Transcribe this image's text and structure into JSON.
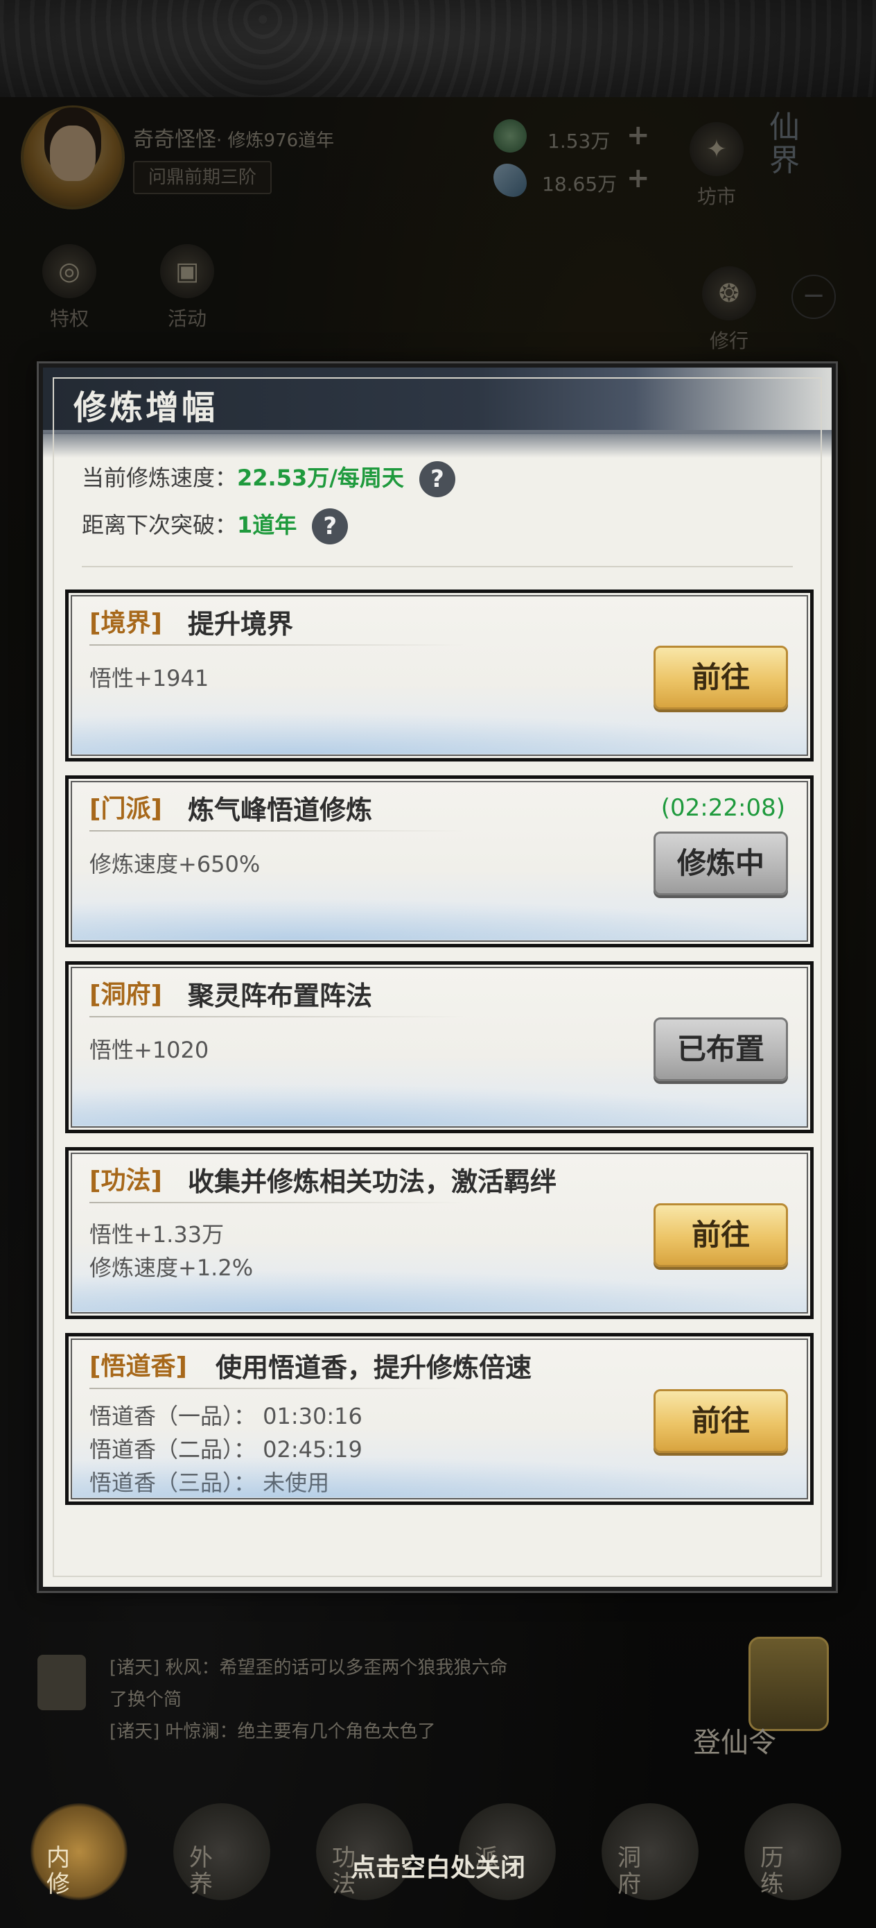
{
  "player": {
    "name": "奇奇怪怪",
    "cultivation_years": "· 修炼976道年",
    "realm": "问鼎前期三阶"
  },
  "currency": [
    {
      "icon": "spirit-stone-icon",
      "amount": "1.53万",
      "color": "#4a7d5a"
    },
    {
      "icon": "jade-icon",
      "amount": "18.65万",
      "color": "#5a86a8"
    }
  ],
  "header": {
    "market_label": "坊市",
    "realm_world": "仙界",
    "privilege_label": "特权",
    "event_label": "活动",
    "practice_label": "修行"
  },
  "modal": {
    "title": "修炼增幅",
    "speed_label": "当前修炼速度：",
    "speed_value": "22.53万/每周天",
    "breakthrough_label": "距离下次突破：",
    "breakthrough_value": "1道年",
    "help": "?",
    "cards": [
      {
        "tag": "[境界]",
        "title": "提升境界",
        "lines": [
          "悟性+1941"
        ],
        "button": "前往",
        "button_style": "gold"
      },
      {
        "tag": "[门派]",
        "title": "炼气峰悟道修炼",
        "lines": [
          "修炼速度+650%"
        ],
        "timer": "(02:22:08)",
        "button": "修炼中",
        "button_style": "gray"
      },
      {
        "tag": "[洞府]",
        "title": "聚灵阵布置阵法",
        "lines": [
          "悟性+1020"
        ],
        "button": "已布置",
        "button_style": "gray"
      },
      {
        "tag": "[功法]",
        "title": "收集并修炼相关功法，激活羁绊",
        "lines": [
          "悟性+1.33万",
          "修炼速度+1.2%"
        ],
        "button": "前往",
        "button_style": "gold"
      },
      {
        "tag": "[悟道香]",
        "title": "使用悟道香，提升修炼倍速",
        "lines": [
          "悟道香（一品）： 01:30:16",
          "悟道香（二品）： 02:45:19",
          "悟道香（三品）： 未使用"
        ],
        "button": "前往",
        "button_style": "gold"
      }
    ]
  },
  "chat": {
    "lines": [
      "[诸天] 秋风：希望歪的话可以多歪两个狼我狼六命",
      "了换个简",
      "[诸天] 叶惊澜：绝主要有几个角色太色了"
    ]
  },
  "dengxian_label": "登仙令",
  "bottom_nav": [
    {
      "label": "内修",
      "active": true
    },
    {
      "label": "外养",
      "active": false
    },
    {
      "label": "功法",
      "active": false
    },
    {
      "label": "派",
      "active": false
    },
    {
      "label": "洞府",
      "active": false
    },
    {
      "label": "历练",
      "active": false
    }
  ],
  "close_hint": "点击空白处关闭"
}
